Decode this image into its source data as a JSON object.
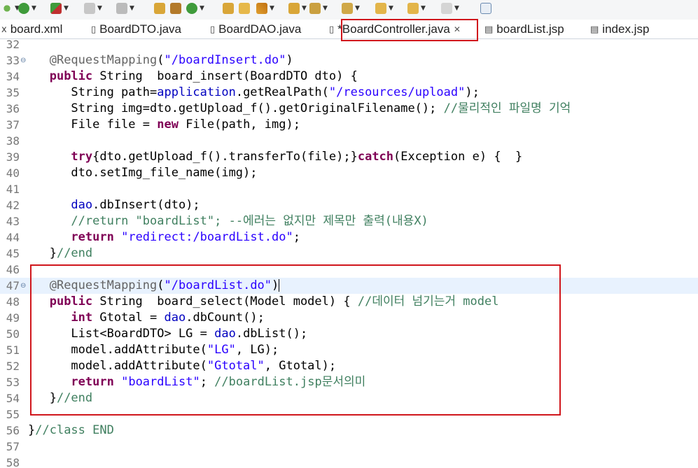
{
  "toolbar": {
    "icons": [
      "debug-run",
      "run",
      "external-tools",
      "stop",
      "step",
      "new-java",
      "new-package",
      "new-class",
      "open-type",
      "open-task",
      "search",
      "annotation-nav",
      "back",
      "forward",
      "back-history",
      "forward-history",
      "pin-editor"
    ]
  },
  "tabs": [
    {
      "label": "board.xml",
      "icon": "xml-file-icon"
    },
    {
      "label": "BoardDTO.java",
      "icon": "java-file-icon"
    },
    {
      "label": "BoardDAO.java",
      "icon": "java-file-icon"
    },
    {
      "label": "*BoardController.java",
      "icon": "java-file-icon",
      "active": true
    },
    {
      "label": "boardList.jsp",
      "icon": "jsp-file-icon"
    },
    {
      "label": "index.jsp",
      "icon": "jsp-file-icon"
    }
  ],
  "editor": {
    "lines": [
      {
        "n": "32",
        "code": ""
      },
      {
        "n": "33",
        "code": "   @RequestMapping(\"/boardInsert.do\")"
      },
      {
        "n": "34",
        "code": "   public String  board_insert(BoardDTO dto) {"
      },
      {
        "n": "35",
        "code": "      String path=application.getRealPath(\"/resources/upload\");"
      },
      {
        "n": "36",
        "code": "      String img=dto.getUpload_f().getOriginalFilename(); //물리적인 파일명 기억"
      },
      {
        "n": "37",
        "code": "      File file = new File(path, img);"
      },
      {
        "n": "38",
        "code": ""
      },
      {
        "n": "39",
        "code": "      try{dto.getUpload_f().transferTo(file);}catch(Exception e) {  }"
      },
      {
        "n": "40",
        "code": "      dto.setImg_file_name(img);"
      },
      {
        "n": "41",
        "code": ""
      },
      {
        "n": "42",
        "code": "      dao.dbInsert(dto);"
      },
      {
        "n": "43",
        "code": "      //return \"boardList\"; --에러는 없지만 제목만 출력(내용X)"
      },
      {
        "n": "44",
        "code": "      return \"redirect:/boardList.do\";"
      },
      {
        "n": "45",
        "code": "   }//end"
      },
      {
        "n": "46",
        "code": ""
      },
      {
        "n": "47",
        "code": "   @RequestMapping(\"/boardList.do\")"
      },
      {
        "n": "48",
        "code": "   public String  board_select(Model model) { //데이터 넘기는거 model"
      },
      {
        "n": "49",
        "code": "      int Gtotal = dao.dbCount();"
      },
      {
        "n": "50",
        "code": "      List<BoardDTO> LG = dao.dbList();"
      },
      {
        "n": "51",
        "code": "      model.addAttribute(\"LG\", LG);"
      },
      {
        "n": "52",
        "code": "      model.addAttribute(\"Gtotal\", Gtotal);"
      },
      {
        "n": "53",
        "code": "      return \"boardList\"; //boardList.jsp문서의미"
      },
      {
        "n": "54",
        "code": "   }//end"
      },
      {
        "n": "55",
        "code": ""
      },
      {
        "n": "56",
        "code": "}//class END"
      },
      {
        "n": "57",
        "code": ""
      },
      {
        "n": "58",
        "code": ""
      }
    ]
  },
  "colors": {
    "highlight": "#d0161c",
    "keyword": "#7f0055",
    "string": "#2a00ff",
    "comment": "#3f7f5f",
    "annotation": "#646464",
    "field": "#0000c0",
    "current_line": "#e8f2fe"
  }
}
